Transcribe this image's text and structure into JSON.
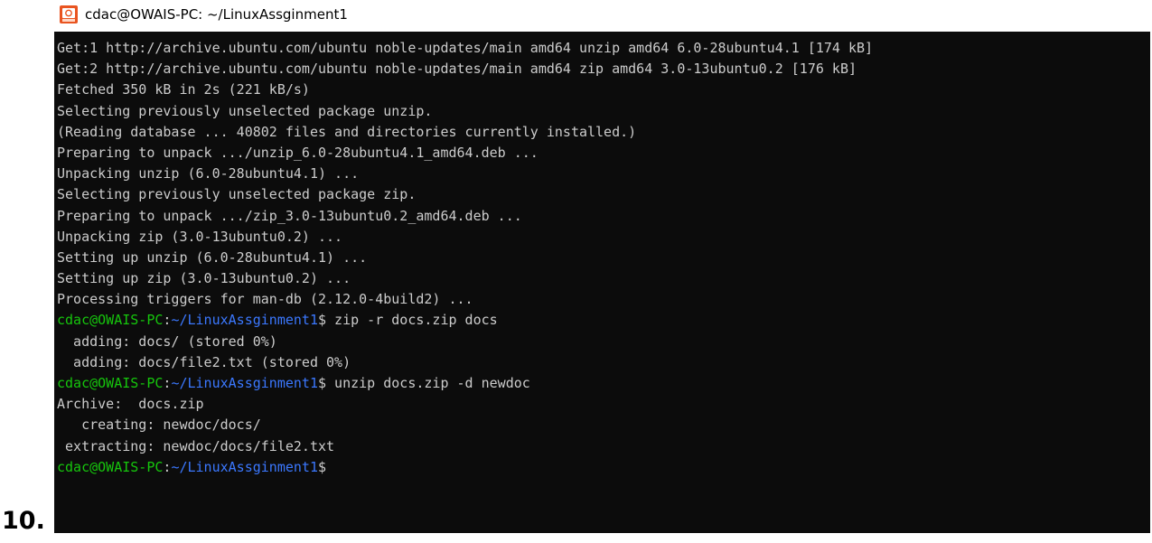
{
  "window": {
    "title": "cdac@OWAIS-PC: ~/LinuxAssginment1",
    "icon": "ubuntu-terminal-icon"
  },
  "terminal": {
    "output": [
      "Get:1 http://archive.ubuntu.com/ubuntu noble-updates/main amd64 unzip amd64 6.0-28ubuntu4.1 [174 kB]",
      "Get:2 http://archive.ubuntu.com/ubuntu noble-updates/main amd64 zip amd64 3.0-13ubuntu0.2 [176 kB]",
      "Fetched 350 kB in 2s (221 kB/s)",
      "Selecting previously unselected package unzip.",
      "(Reading database ... 40802 files and directories currently installed.)",
      "Preparing to unpack .../unzip_6.0-28ubuntu4.1_amd64.deb ...",
      "Unpacking unzip (6.0-28ubuntu4.1) ...",
      "Selecting previously unselected package zip.",
      "Preparing to unpack .../zip_3.0-13ubuntu0.2_amd64.deb ...",
      "Unpacking zip (3.0-13ubuntu0.2) ...",
      "Setting up unzip (6.0-28ubuntu4.1) ...",
      "Setting up zip (3.0-13ubuntu0.2) ...",
      "Processing triggers for man-db (2.12.0-4build2) ..."
    ],
    "prompt": {
      "user_host": "cdac@OWAIS-PC",
      "separator": ":",
      "path": "~/LinuxAssginment1",
      "symbol": "$"
    },
    "command1": " zip -r docs.zip docs",
    "command1_output": [
      "  adding: docs/ (stored 0%)",
      "  adding: docs/file2.txt (stored 0%)"
    ],
    "command2": " unzip docs.zip -d newdoc",
    "command2_output": [
      "Archive:  docs.zip",
      "   creating: newdoc/docs/",
      " extracting: newdoc/docs/file2.txt"
    ],
    "colors": {
      "background": "#0c0c0c",
      "text": "#cccccc",
      "prompt_user": "#16c60c",
      "prompt_path": "#3b78ff"
    }
  },
  "document": {
    "step_number": "10."
  }
}
